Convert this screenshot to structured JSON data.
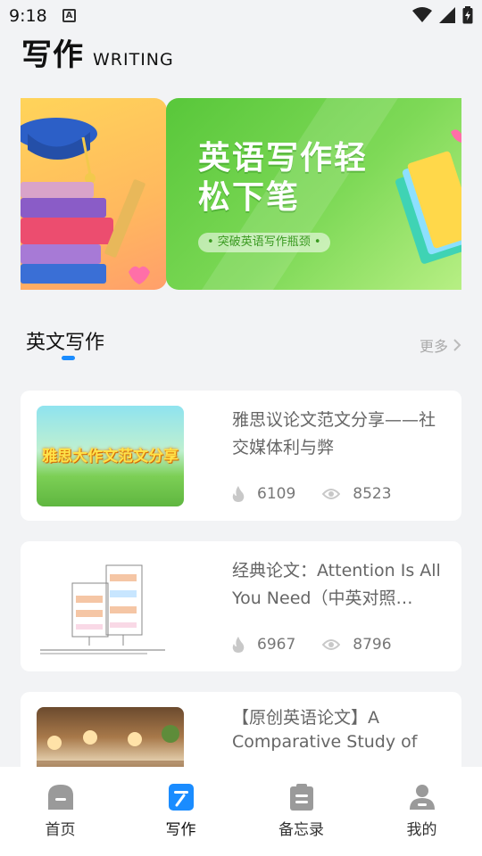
{
  "status_bar": {
    "time": "9:18",
    "notification_glyph": "A"
  },
  "header": {
    "title": "写作",
    "subtitle": "WRITING"
  },
  "banner": {
    "heading": "英语写作轻松下笔",
    "pill_text": "• 突破英语写作瓶颈 •",
    "colors": {
      "left_bg": "#ffc95c",
      "right_bg": "#6fd14a"
    }
  },
  "section": {
    "title": "英文写作",
    "more_label": "更多",
    "accent_color": "#1a8cff"
  },
  "articles": [
    {
      "title": "雅思议论文范文分享——社交媒体利与弊",
      "thumb_caption": "雅思大作文范文分享",
      "hot": "6109",
      "views": "8523"
    },
    {
      "title": "经典论文：Attention Is All You Need（中英对照…",
      "hot": "6967",
      "views": "8796"
    },
    {
      "title": "【原创英语论文】A Comparative Study of C…"
    }
  ],
  "tabbar": {
    "items": [
      {
        "label": "首页",
        "icon": "home-icon"
      },
      {
        "label": "写作",
        "icon": "writing-icon",
        "active": true
      },
      {
        "label": "备忘录",
        "icon": "memo-icon"
      },
      {
        "label": "我的",
        "icon": "profile-icon"
      }
    ],
    "active_color": "#1a8cff",
    "inactive_color": "#9a9a9a"
  }
}
